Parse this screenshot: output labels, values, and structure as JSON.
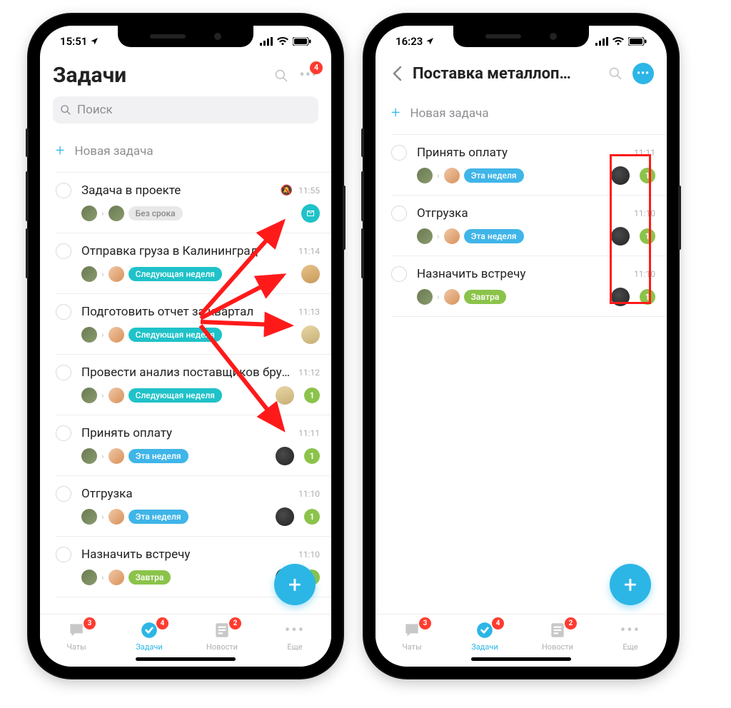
{
  "colors": {
    "accent": "#2cb6e6",
    "badge_red": "#ff3b30",
    "badge_green": "#8bc34a"
  },
  "phones": {
    "left": {
      "status": {
        "time": "15:51"
      },
      "header": {
        "title": "Задачи",
        "notif_count": "4"
      },
      "search": {
        "placeholder": "Поиск"
      },
      "new_task_label": "Новая задача",
      "tasks": [
        {
          "title": "Задача в проекте",
          "muted": true,
          "time": "11:55",
          "chip": {
            "label": "Без срока",
            "style": "grey"
          },
          "avatars": [
            "av1",
            "av1"
          ],
          "proj_icon": "teal"
        },
        {
          "title": "Отправка груза в Калининград",
          "time": "11:14",
          "chip": {
            "label": "Следующая неделя",
            "style": "teal"
          },
          "avatars": [
            "av1",
            "av2"
          ],
          "proj_icon": "wood"
        },
        {
          "title": "Подготовить отчет за квартал",
          "time": "11:13",
          "chip": {
            "label": "Следующая неделя",
            "style": "teal"
          },
          "avatars": [
            "av1",
            "av2"
          ],
          "proj_icon": "wood2"
        },
        {
          "title": "Провести анализ поставщиков бруса",
          "time": "11:12",
          "chip": {
            "label": "Следующая неделя",
            "style": "teal"
          },
          "avatars": [
            "av1",
            "av2"
          ],
          "proj_icon": "wood2",
          "badge": "1"
        },
        {
          "title": "Принять оплату",
          "time": "11:11",
          "chip": {
            "label": "Эта неделя",
            "style": "blue"
          },
          "avatars": [
            "av1",
            "av2"
          ],
          "proj_icon": "dark",
          "badge": "1"
        },
        {
          "title": "Отгрузка",
          "time": "11:10",
          "chip": {
            "label": "Эта неделя",
            "style": "blue"
          },
          "avatars": [
            "av1",
            "av2"
          ],
          "proj_icon": "dark",
          "badge": "1"
        },
        {
          "title": "Назначить встречу",
          "time": "11:10",
          "chip": {
            "label": "Завтра",
            "style": "green"
          },
          "avatars": [
            "av1",
            "av2"
          ],
          "proj_icon": "dark",
          "badge": "1"
        }
      ]
    },
    "right": {
      "status": {
        "time": "16:23"
      },
      "header": {
        "title": "Поставка металлоп…"
      },
      "new_task_label": "Новая задача",
      "tasks": [
        {
          "title": "Принять оплату",
          "time": "11:11",
          "chip": {
            "label": "Эта неделя",
            "style": "blue"
          },
          "avatars": [
            "av1",
            "av2"
          ],
          "proj_icon": "dark",
          "badge": "1"
        },
        {
          "title": "Отгрузка",
          "time": "11:10",
          "chip": {
            "label": "Эта неделя",
            "style": "blue"
          },
          "avatars": [
            "av1",
            "av2"
          ],
          "proj_icon": "dark",
          "badge": "1"
        },
        {
          "title": "Назначить встречу",
          "time": "11:10",
          "chip": {
            "label": "Завтра",
            "style": "green"
          },
          "avatars": [
            "av1",
            "av2"
          ],
          "proj_icon": "dark",
          "badge": "1"
        }
      ]
    }
  },
  "tabbar": {
    "tabs": [
      {
        "label": "Чаты",
        "badge": "3"
      },
      {
        "label": "Задачи",
        "badge": "4",
        "active": true
      },
      {
        "label": "Новости",
        "badge": "2"
      },
      {
        "label": "Еще"
      }
    ]
  }
}
